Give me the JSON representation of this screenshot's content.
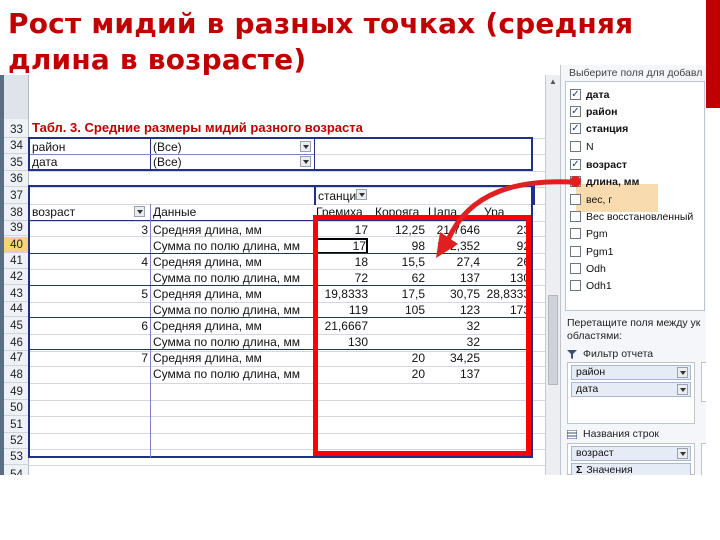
{
  "slide": {
    "title": "Рост мидий в разных точках (средняя длина в возрасте)"
  },
  "sheet": {
    "rows": [
      "33",
      "34",
      "35",
      "36",
      "37",
      "38",
      "39",
      "40",
      "41",
      "42",
      "43",
      "44",
      "45",
      "46",
      "47",
      "48",
      "49",
      "50",
      "51",
      "52",
      "53",
      "54"
    ],
    "active_row": "40",
    "table_title": "Табл. 3. Средние размеры мидий разного возраста",
    "filters": [
      {
        "field": "район",
        "value": "(Все)"
      },
      {
        "field": "дата",
        "value": "(Все)"
      }
    ],
    "column_field": "станци",
    "row_field": "возраст",
    "data_field": "Данные",
    "columns": [
      "Гремиха",
      "Корояга",
      "Цапа",
      "Ура"
    ],
    "groups": [
      {
        "age": "3",
        "rows": [
          {
            "label": "Средняя длина, мм",
            "values": [
              "17",
              "12,25",
              "21,7646",
              "23"
            ]
          },
          {
            "label": "Сумма по полю длина, мм",
            "values": [
              "17",
              "98",
              "152,352",
              "92"
            ]
          }
        ]
      },
      {
        "age": "4",
        "rows": [
          {
            "label": "Средняя длина, мм",
            "values": [
              "18",
              "15,5",
              "27,4",
              "26"
            ]
          },
          {
            "label": "Сумма по полю длина, мм",
            "values": [
              "72",
              "62",
              "137",
              "130"
            ]
          }
        ]
      },
      {
        "age": "5",
        "rows": [
          {
            "label": "Средняя длина, мм",
            "values": [
              "19,8333",
              "17,5",
              "30,75",
              "28,8333"
            ]
          },
          {
            "label": "Сумма по полю длина, мм",
            "values": [
              "119",
              "105",
              "123",
              "173"
            ]
          }
        ]
      },
      {
        "age": "6",
        "rows": [
          {
            "label": "Средняя длина, мм",
            "values": [
              "21,6667",
              "",
              "32",
              ""
            ]
          },
          {
            "label": "Сумма по полю длина, мм",
            "values": [
              "130",
              "",
              "32",
              ""
            ]
          }
        ]
      },
      {
        "age": "7",
        "rows": [
          {
            "label": "Средняя длина, мм",
            "values": [
              "",
              "20",
              "34,25",
              ""
            ]
          },
          {
            "label": "Сумма по полю длина, мм",
            "values": [
              "",
              "20",
              "137",
              ""
            ]
          }
        ]
      }
    ]
  },
  "panel": {
    "header": "Выберите поля для добавл",
    "fields": [
      {
        "label": "дата",
        "checked": true,
        "bold": true
      },
      {
        "label": "район",
        "checked": true,
        "bold": true
      },
      {
        "label": "станция",
        "checked": true,
        "bold": true
      },
      {
        "label": "N",
        "checked": false,
        "bold": false
      },
      {
        "label": "возраст",
        "checked": true,
        "bold": true
      },
      {
        "label": "длина, мм",
        "checked": true,
        "bold": true
      },
      {
        "label": "вес, г",
        "checked": false,
        "bold": false
      },
      {
        "label": "Вес восстановленный",
        "checked": false,
        "bold": false
      },
      {
        "label": "Pgm",
        "checked": false,
        "bold": false
      },
      {
        "label": "Pgm1",
        "checked": false,
        "bold": false
      },
      {
        "label": "Odh",
        "checked": false,
        "bold": false
      },
      {
        "label": "Odh1",
        "checked": false,
        "bold": false
      }
    ],
    "drag_text": "Перетащите поля между ук областями:",
    "report_filter_label": "Фильтр отчета",
    "report_filter_items": [
      "район",
      "дата"
    ],
    "row_labels_label": "Названия строк",
    "row_label_items": [
      "возраст",
      "Значения"
    ]
  },
  "colors": {
    "accent": "#c00000",
    "highlight_frame": "#ff0000",
    "pivot_border": "#1f2f8a"
  }
}
